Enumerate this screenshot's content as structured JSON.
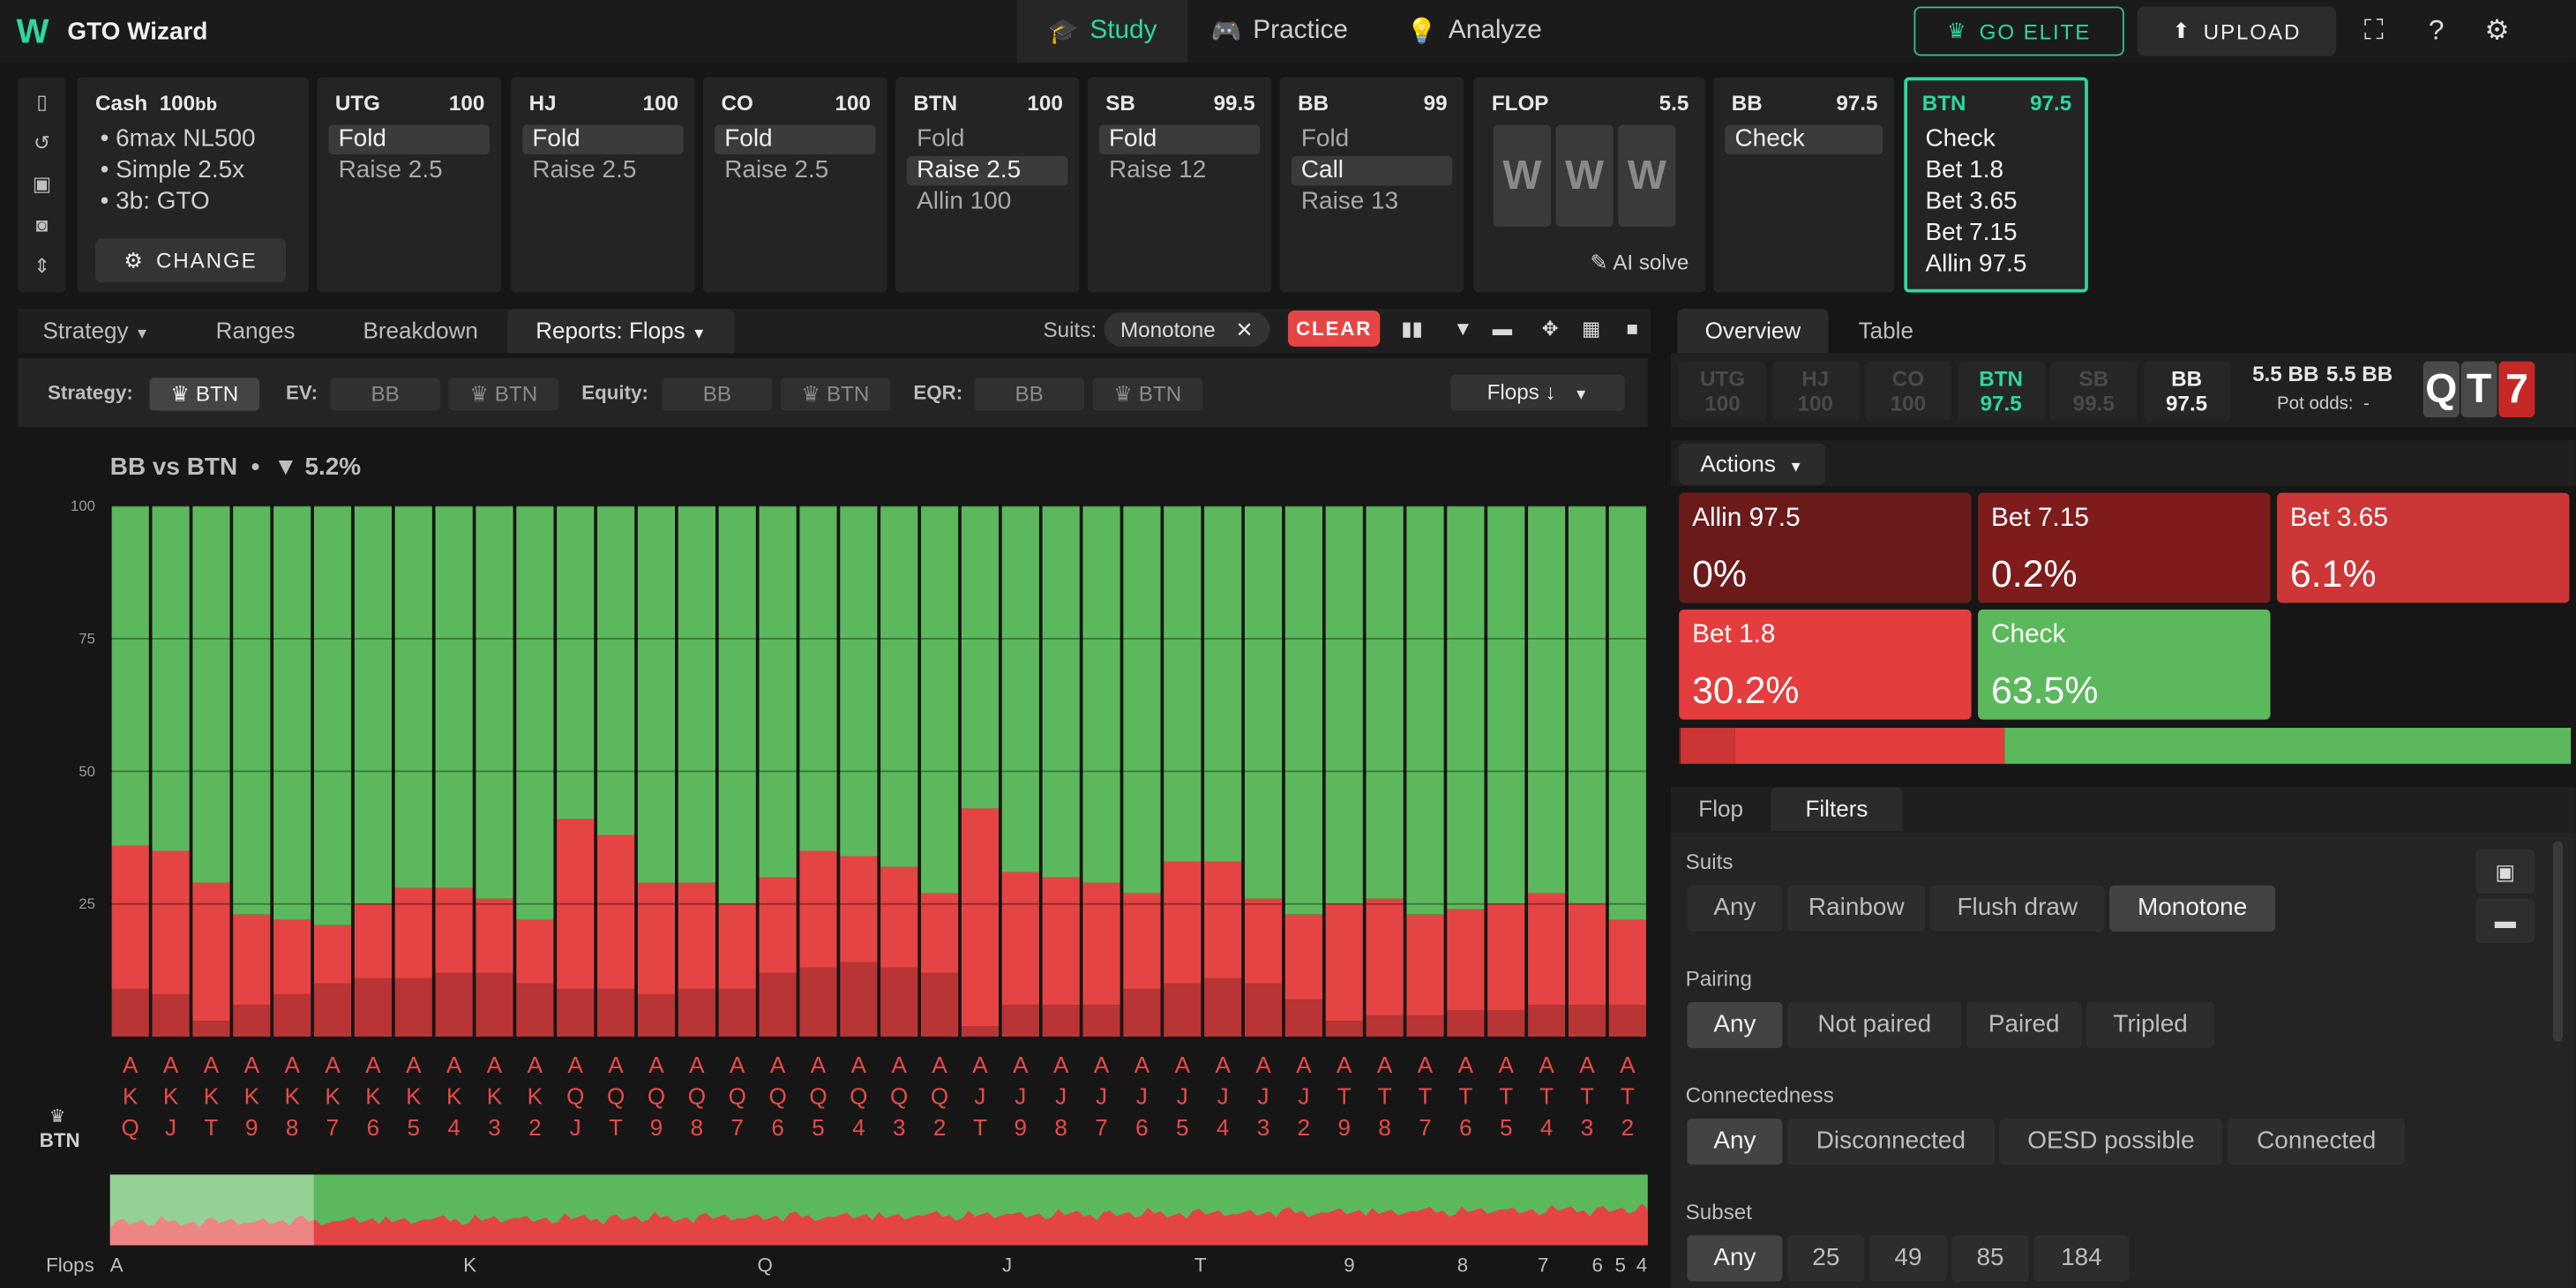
{
  "app": {
    "logo": "W",
    "title": "GTO Wizard"
  },
  "nav": [
    {
      "label": "Study",
      "icon": "graduation-cap-icon",
      "glyph": "🎓",
      "active": true
    },
    {
      "label": "Practice",
      "icon": "gamepad-icon",
      "glyph": "🎮",
      "active": false
    },
    {
      "label": "Analyze",
      "icon": "lightbulb-icon",
      "glyph": "💡",
      "active": false
    }
  ],
  "top_buttons": {
    "elite": "GO ELITE",
    "upload": "UPLOAD"
  },
  "game": {
    "type": "Cash",
    "depth": "100",
    "depth_unit": "bb",
    "bullets": [
      "6max NL500",
      "Simple 2.5x",
      "3b: GTO"
    ],
    "change": "CHANGE"
  },
  "seats": [
    {
      "pos": "UTG",
      "stack": "100",
      "options": [
        "Fold",
        "Raise 2.5"
      ],
      "selected": 0
    },
    {
      "pos": "HJ",
      "stack": "100",
      "options": [
        "Fold",
        "Raise 2.5"
      ],
      "selected": 0
    },
    {
      "pos": "CO",
      "stack": "100",
      "options": [
        "Fold",
        "Raise 2.5"
      ],
      "selected": 0
    },
    {
      "pos": "BTN",
      "stack": "100",
      "options": [
        "Fold",
        "Raise 2.5",
        "Allin 100"
      ],
      "selected": 1
    },
    {
      "pos": "SB",
      "stack": "99.5",
      "options": [
        "Fold",
        "Raise 12"
      ],
      "selected": 0
    },
    {
      "pos": "BB",
      "stack": "99",
      "options": [
        "Fold",
        "Call",
        "Raise 13"
      ],
      "selected": 1
    }
  ],
  "flop_card": {
    "label": "FLOP",
    "pot": "5.5",
    "cards": [
      "W",
      "W",
      "W"
    ],
    "ai": "AI solve"
  },
  "bb_card": {
    "pos": "BB",
    "stack": "97.5",
    "options": [
      "Check"
    ]
  },
  "btn_card": {
    "pos": "BTN",
    "stack": "97.5",
    "options": [
      "Check",
      "Bet 1.8",
      "Bet 3.65",
      "Bet 7.15",
      "Allin 97.5"
    ]
  },
  "tabs": [
    "Strategy",
    "Ranges",
    "Breakdown",
    "Reports: Flops"
  ],
  "suits_filter": {
    "label": "Suits:",
    "value": "Monotone",
    "clear": "CLEAR"
  },
  "filters": {
    "strategy_label": "Strategy:",
    "strategy": [
      "BTN"
    ],
    "ev_label": "EV:",
    "ev": [
      "BB",
      "BTN"
    ],
    "equity_label": "Equity:",
    "equity": [
      "BB",
      "BTN"
    ],
    "eqr_label": "EQR:",
    "eqr": [
      "BB",
      "BTN"
    ],
    "sort": "Flops ↓"
  },
  "chart_header": {
    "matchup": "BB vs BTN",
    "sep": "•",
    "filter_pct": "5.2%"
  },
  "chart_data": {
    "type": "bar",
    "stacked": true,
    "ylim": [
      0,
      100
    ],
    "yticks": [
      100,
      75,
      50,
      25
    ],
    "player": "BTN",
    "categories": [
      "AKQ",
      "AKJ",
      "AKT",
      "AK9",
      "AK8",
      "AK7",
      "AK6",
      "AK5",
      "AK4",
      "AK3",
      "AK2",
      "AQJ",
      "AQT",
      "AQ9",
      "AQ8",
      "AQ7",
      "AQ6",
      "AQ5",
      "AQ4",
      "AQ3",
      "AQ2",
      "AJT",
      "AJ9",
      "AJ8",
      "AJ7",
      "AJ6",
      "AJ5",
      "AJ4",
      "AJ3",
      "AJ2",
      "AT9",
      "AT8",
      "AT7",
      "AT6",
      "AT5",
      "AT4",
      "AT3",
      "AT2"
    ],
    "series": [
      {
        "name": "Bet 3.65",
        "color": "#b93434",
        "values": [
          9,
          8,
          3,
          6,
          8,
          10,
          11,
          11,
          12,
          12,
          10,
          9,
          9,
          8,
          9,
          9,
          12,
          13,
          14,
          13,
          12,
          2,
          6,
          6,
          6,
          9,
          10,
          11,
          10,
          7,
          3,
          4,
          4,
          5,
          5,
          6,
          6,
          6
        ]
      },
      {
        "name": "Bet 1.8",
        "color": "#e54444",
        "values": [
          27,
          27,
          26,
          17,
          14,
          11,
          14,
          17,
          16,
          14,
          12,
          32,
          29,
          21,
          20,
          16,
          18,
          22,
          20,
          19,
          15,
          41,
          25,
          24,
          23,
          18,
          23,
          22,
          16,
          16,
          22,
          22,
          19,
          19,
          20,
          21,
          19,
          16
        ]
      },
      {
        "name": "Check",
        "color": "#5cb85c",
        "values": [
          64,
          65,
          71,
          77,
          78,
          79,
          75,
          72,
          72,
          74,
          78,
          59,
          62,
          71,
          71,
          75,
          70,
          65,
          66,
          68,
          73,
          57,
          69,
          70,
          71,
          73,
          67,
          67,
          74,
          77,
          75,
          74,
          77,
          76,
          75,
          73,
          75,
          78
        ]
      }
    ],
    "axis_labels": [
      "A",
      "K",
      "Q",
      "J",
      "T",
      "9",
      "8",
      "7",
      "6",
      "5",
      "4"
    ]
  },
  "right_tabs": [
    "Overview",
    "Table"
  ],
  "table_seats": [
    {
      "pos": "UTG",
      "stack": "100"
    },
    {
      "pos": "HJ",
      "stack": "100"
    },
    {
      "pos": "CO",
      "stack": "100"
    },
    {
      "pos": "BTN",
      "stack": "97.5"
    },
    {
      "pos": "SB",
      "stack": "99.5"
    },
    {
      "pos": "BB",
      "stack": "97.5"
    }
  ],
  "pot": {
    "main": "5.5 BB",
    "total": "5.5 BB",
    "odds_label": "Pot odds:",
    "odds_value": "-"
  },
  "board": [
    {
      "rank": "Q",
      "color": "#4a4a4a"
    },
    {
      "rank": "T",
      "color": "#4a4a4a"
    },
    {
      "rank": "7",
      "color": "#c62828"
    }
  ],
  "actions_label": "Actions",
  "actions": [
    {
      "name": "Allin 97.5",
      "value": "0%",
      "color": "#6b1a1a",
      "freq": 0
    },
    {
      "name": "Bet 7.15",
      "value": "0.2%",
      "color": "#7e1c1c",
      "freq": 0.2
    },
    {
      "name": "Bet 3.65",
      "value": "6.1%",
      "color": "#cc3636",
      "freq": 6.1
    },
    {
      "name": "Bet 1.8",
      "value": "30.2%",
      "color": "#e33d3d",
      "freq": 30.2
    },
    {
      "name": "Check",
      "value": "63.5%",
      "color": "#5cb85c",
      "freq": 63.5
    }
  ],
  "filter_tabs": [
    "Flop",
    "Filters"
  ],
  "filter_sections": [
    {
      "label": "Suits",
      "options": [
        "Any",
        "Rainbow",
        "Flush draw",
        "Monotone"
      ],
      "selected": 3
    },
    {
      "label": "Pairing",
      "options": [
        "Any",
        "Not paired",
        "Paired",
        "Tripled"
      ],
      "selected": 0
    },
    {
      "label": "Connectedness",
      "options": [
        "Any",
        "Disconnected",
        "OESD possible",
        "Connected"
      ],
      "selected": 0
    },
    {
      "label": "Subset",
      "options": [
        "Any",
        "25",
        "49",
        "85",
        "184"
      ],
      "selected": 0
    }
  ]
}
